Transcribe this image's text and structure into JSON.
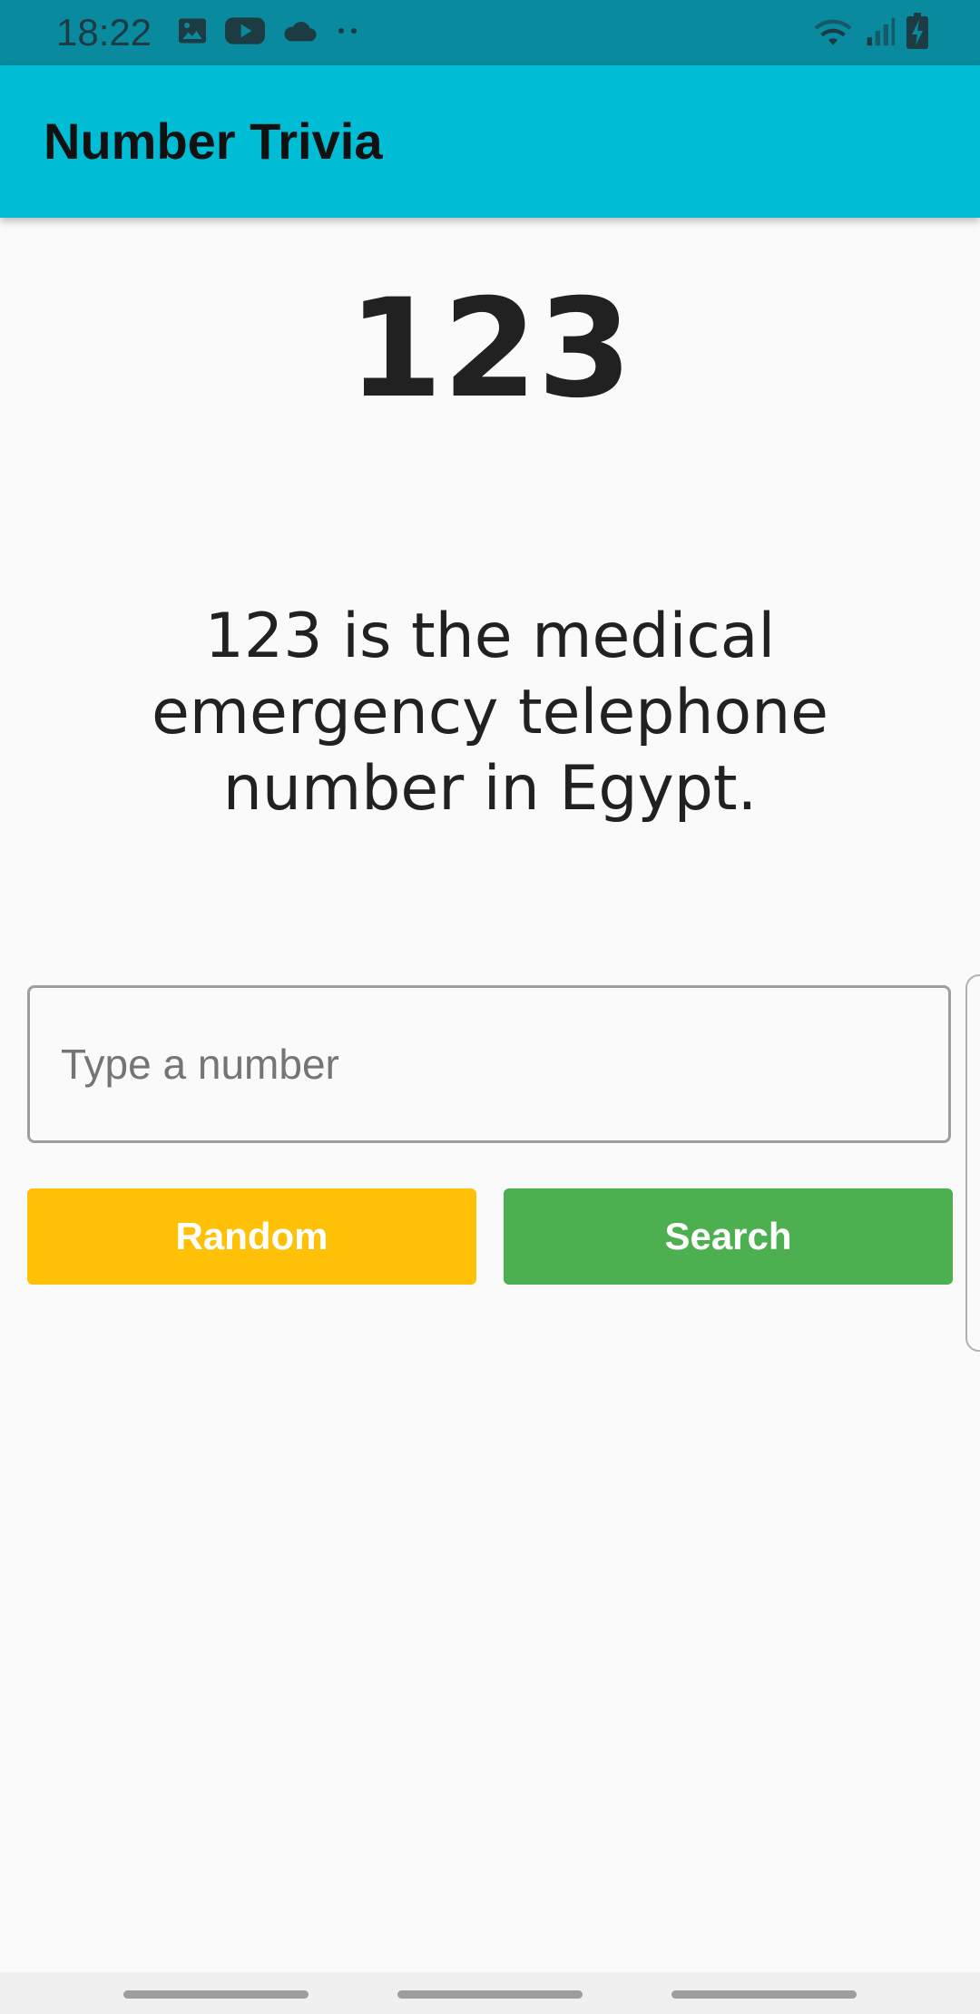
{
  "status_bar": {
    "time": "18:22",
    "left_icons": [
      "image-icon",
      "youtube-icon",
      "cloud-icon",
      "more-dots-icon"
    ],
    "right_icons": [
      "wifi-icon",
      "signal-icon",
      "battery-charging-icon"
    ]
  },
  "app_bar": {
    "title": "Number Trivia",
    "color": "#00bcd4"
  },
  "trivia": {
    "number": "123",
    "text": "123 is the medical emergency telephone number in Egypt."
  },
  "input": {
    "placeholder": "Type a number",
    "value": ""
  },
  "buttons": {
    "random_label": "Random",
    "random_color": "#ffc107",
    "search_label": "Search",
    "search_color": "#4caf50"
  }
}
